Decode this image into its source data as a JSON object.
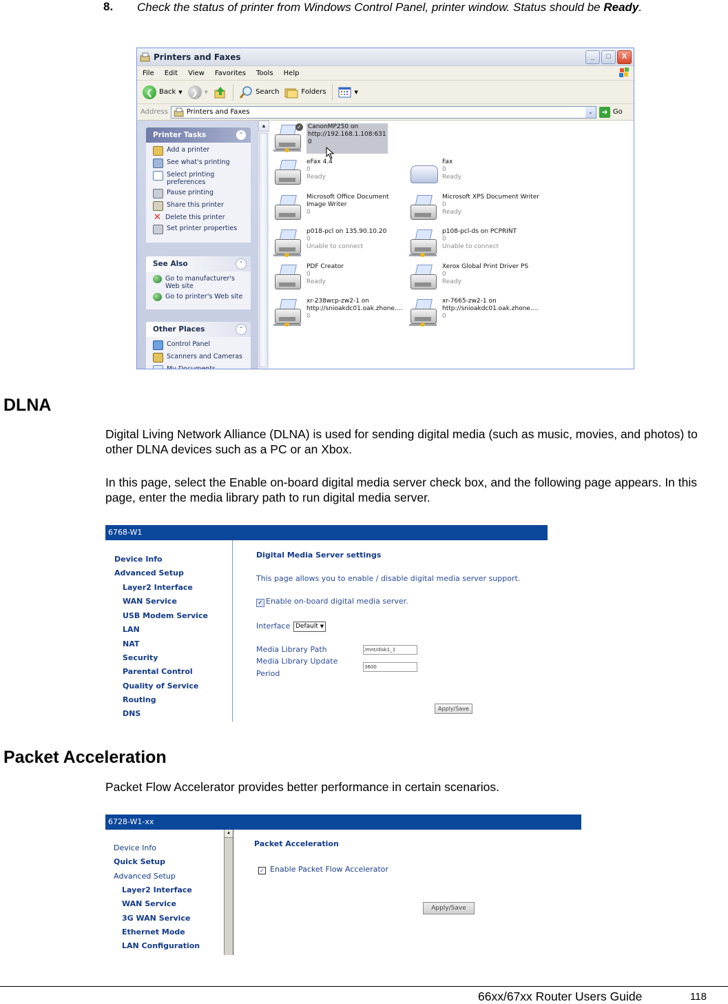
{
  "step": {
    "number": "8.",
    "text": "Check the status of printer from Windows Control Panel, printer window. Status should be ",
    "emphasis": "Ready",
    "end": "."
  },
  "printers_window": {
    "title": "Printers and Faxes",
    "menu": [
      "File",
      "Edit",
      "View",
      "Favorites",
      "Tools",
      "Help"
    ],
    "toolbar": {
      "back": "Back",
      "search": "Search",
      "folders": "Folders"
    },
    "address_label": "Address",
    "address_value": "Printers and Faxes",
    "go": "Go",
    "window_controls": {
      "minimize": "_",
      "maximize": "□",
      "close": "X"
    },
    "panels": [
      {
        "title": "Printer Tasks",
        "items": [
          "Add a printer",
          "See what's printing",
          "Select printing preferences",
          "Pause printing",
          "Share this printer",
          "Delete this printer",
          "Set printer properties"
        ]
      },
      {
        "title": "See Also",
        "items": [
          "Go to manufacturer's Web site",
          "Go to printer's Web site"
        ]
      },
      {
        "title": "Other Places",
        "items": [
          "Control Panel",
          "Scanners and Cameras",
          "My Documents"
        ]
      }
    ],
    "printers": [
      {
        "name": "CanonMP250 on",
        "line2": "http://192.168.1.108:631",
        "count": "0",
        "status": "",
        "selected": true,
        "default": true,
        "type": "network"
      },
      {
        "name": "eFax 4.4",
        "line2": "",
        "count": "0",
        "status": "Ready",
        "type": "local"
      },
      {
        "name": "Fax",
        "line2": "",
        "count": "0",
        "status": "Ready",
        "type": "fax"
      },
      {
        "name": "Microsoft Office Document",
        "line2": "Image Writer",
        "count": "0",
        "status": "",
        "type": "local"
      },
      {
        "name": "Microsoft XPS Document Writer",
        "line2": "",
        "count": "0",
        "status": "Ready",
        "type": "local"
      },
      {
        "name": "p018-pcl on 135.90.10.20",
        "line2": "",
        "count": "0",
        "status": "Unable to connect",
        "type": "network"
      },
      {
        "name": "p108-pcl-ds on PCPRINT",
        "line2": "",
        "count": "0",
        "status": "Unable to connect",
        "type": "network"
      },
      {
        "name": "PDF Creator",
        "line2": "",
        "count": "0",
        "status": "Ready",
        "type": "local"
      },
      {
        "name": "Xerox Global Print Driver PS",
        "line2": "",
        "count": "0",
        "status": "Ready",
        "type": "local"
      },
      {
        "name": "xr-238wcp-zw2-1 on",
        "line2": "http://snioakdc01.oak.zhone....",
        "count": "0",
        "status": "",
        "type": "network"
      },
      {
        "name": "xr-7665-zw2-1 on",
        "line2": "http://snioakdc01.oak.zhone....",
        "count": "0",
        "status": "",
        "type": "network"
      }
    ]
  },
  "dlna": {
    "heading": "DLNA",
    "para1": "Digital Living Network Alliance (DLNA) is used for sending digital media (such as music, movies, and photos) to other DLNA devices such as a PC or an Xbox.",
    "para2": "In this page, select the Enable on-board digital media server check box, and the following page appears. In this page, enter the media library path to run digital media server."
  },
  "router1": {
    "title": "6768-W1",
    "nav": [
      "Device Info",
      "Advanced Setup",
      "Layer2 Interface",
      "WAN Service",
      "USB Modem Service",
      "LAN",
      "NAT",
      "Security",
      "Parental Control",
      "Quality of Service",
      "Routing",
      "DNS"
    ],
    "heading": "Digital Media Server settings",
    "description": "This page allows you to enable / disable digital media server support.",
    "enable_label": "Enable on-board digital media server.",
    "enable_checked": true,
    "interface_label": "Interface",
    "interface_value": "Default",
    "library_path_label": "Media Library Path",
    "library_path_value": "/mnt/disk1_1",
    "update_label_1": "Media Library Update",
    "update_label_2": "Period",
    "update_value": "3600",
    "apply": "Apply/Save"
  },
  "packet": {
    "heading": "Packet Acceleration",
    "para": "Packet Flow Accelerator provides better performance in certain scenarios."
  },
  "router2": {
    "title": "6728-W1-xx",
    "nav": [
      "Device Info",
      "Quick Setup",
      "Advanced Setup",
      "Layer2 Interface",
      "WAN Service",
      "3G WAN Service",
      "Ethernet Mode",
      "LAN Configuration"
    ],
    "heading": "Packet Acceleration",
    "enable_label": "Enable Packet Flow Accelerator",
    "enable_checked": true,
    "apply": "Apply/Save"
  },
  "footer": {
    "title": "66xx/67xx Router Users Guide",
    "page": "118"
  }
}
